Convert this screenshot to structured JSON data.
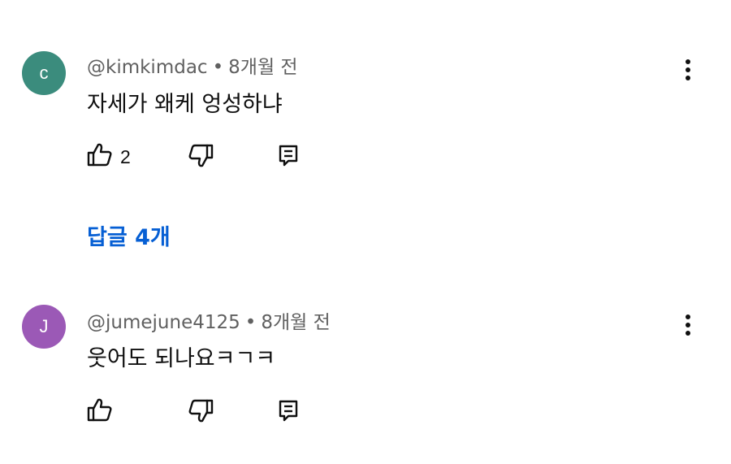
{
  "comments": [
    {
      "avatar_letter": "c",
      "avatar_color": "#3b8c7d",
      "author": "@kimkimdac",
      "separator": "•",
      "time": "8개월 전",
      "text": "자세가 왜케 엉성하냐",
      "like_count": "2",
      "icons": [
        "like-icon",
        "dislike-icon",
        "reply-icon",
        "more-vert-icon"
      ]
    },
    {
      "avatar_letter": "J",
      "avatar_color": "#9b59b6",
      "author": "@jumejune4125",
      "separator": "•",
      "time": "8개월 전",
      "text": "웃어도 되나요ㅋㄱㅋ",
      "like_count": "",
      "icons": [
        "like-icon",
        "dislike-icon",
        "reply-icon",
        "more-vert-icon"
      ]
    }
  ],
  "replies": {
    "label": "답글 4개",
    "color": "#065fd4"
  }
}
